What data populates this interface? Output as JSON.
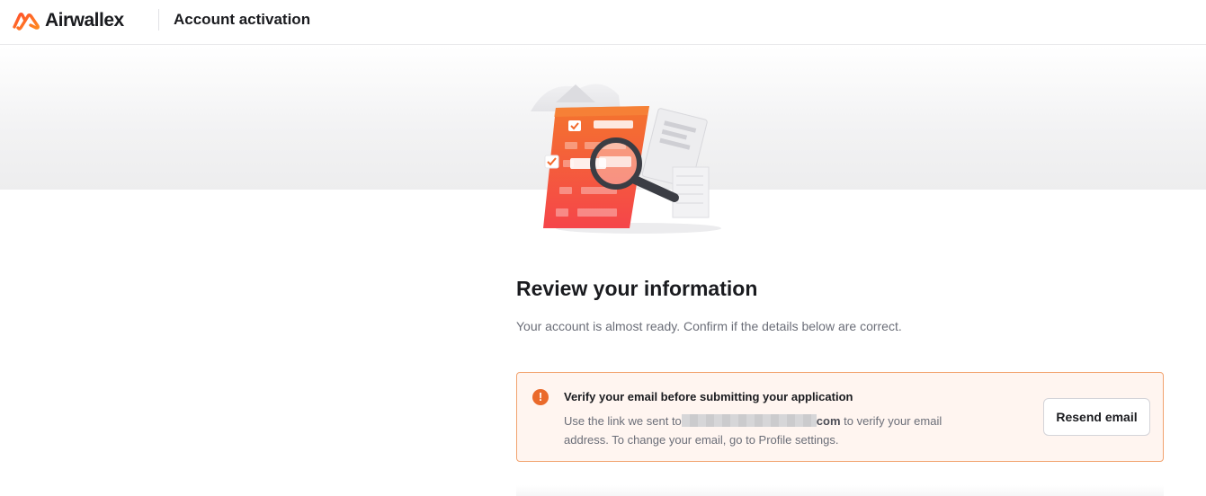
{
  "header": {
    "brand_name": "Airwallex",
    "title": "Account activation"
  },
  "illustration": {
    "icon": "document-review-magnifier-illustration"
  },
  "main": {
    "title": "Review your information",
    "subtitle": "Your account is almost ready. Confirm if the details below are correct."
  },
  "alert": {
    "icon": "warning-icon",
    "icon_glyph": "!",
    "title": "Verify your email before submitting your application",
    "body_prefix": "Use the link we sent to",
    "email_suffix": "com",
    "body_suffix": " to verify your email address. To change your email, go to Profile settings.",
    "button_label": "Resend email"
  },
  "colors": {
    "brand_orange": "#ff5a1f",
    "alert_border": "#f2a36f",
    "alert_background": "#fff5f0",
    "alert_icon": "#ea6a2b"
  }
}
